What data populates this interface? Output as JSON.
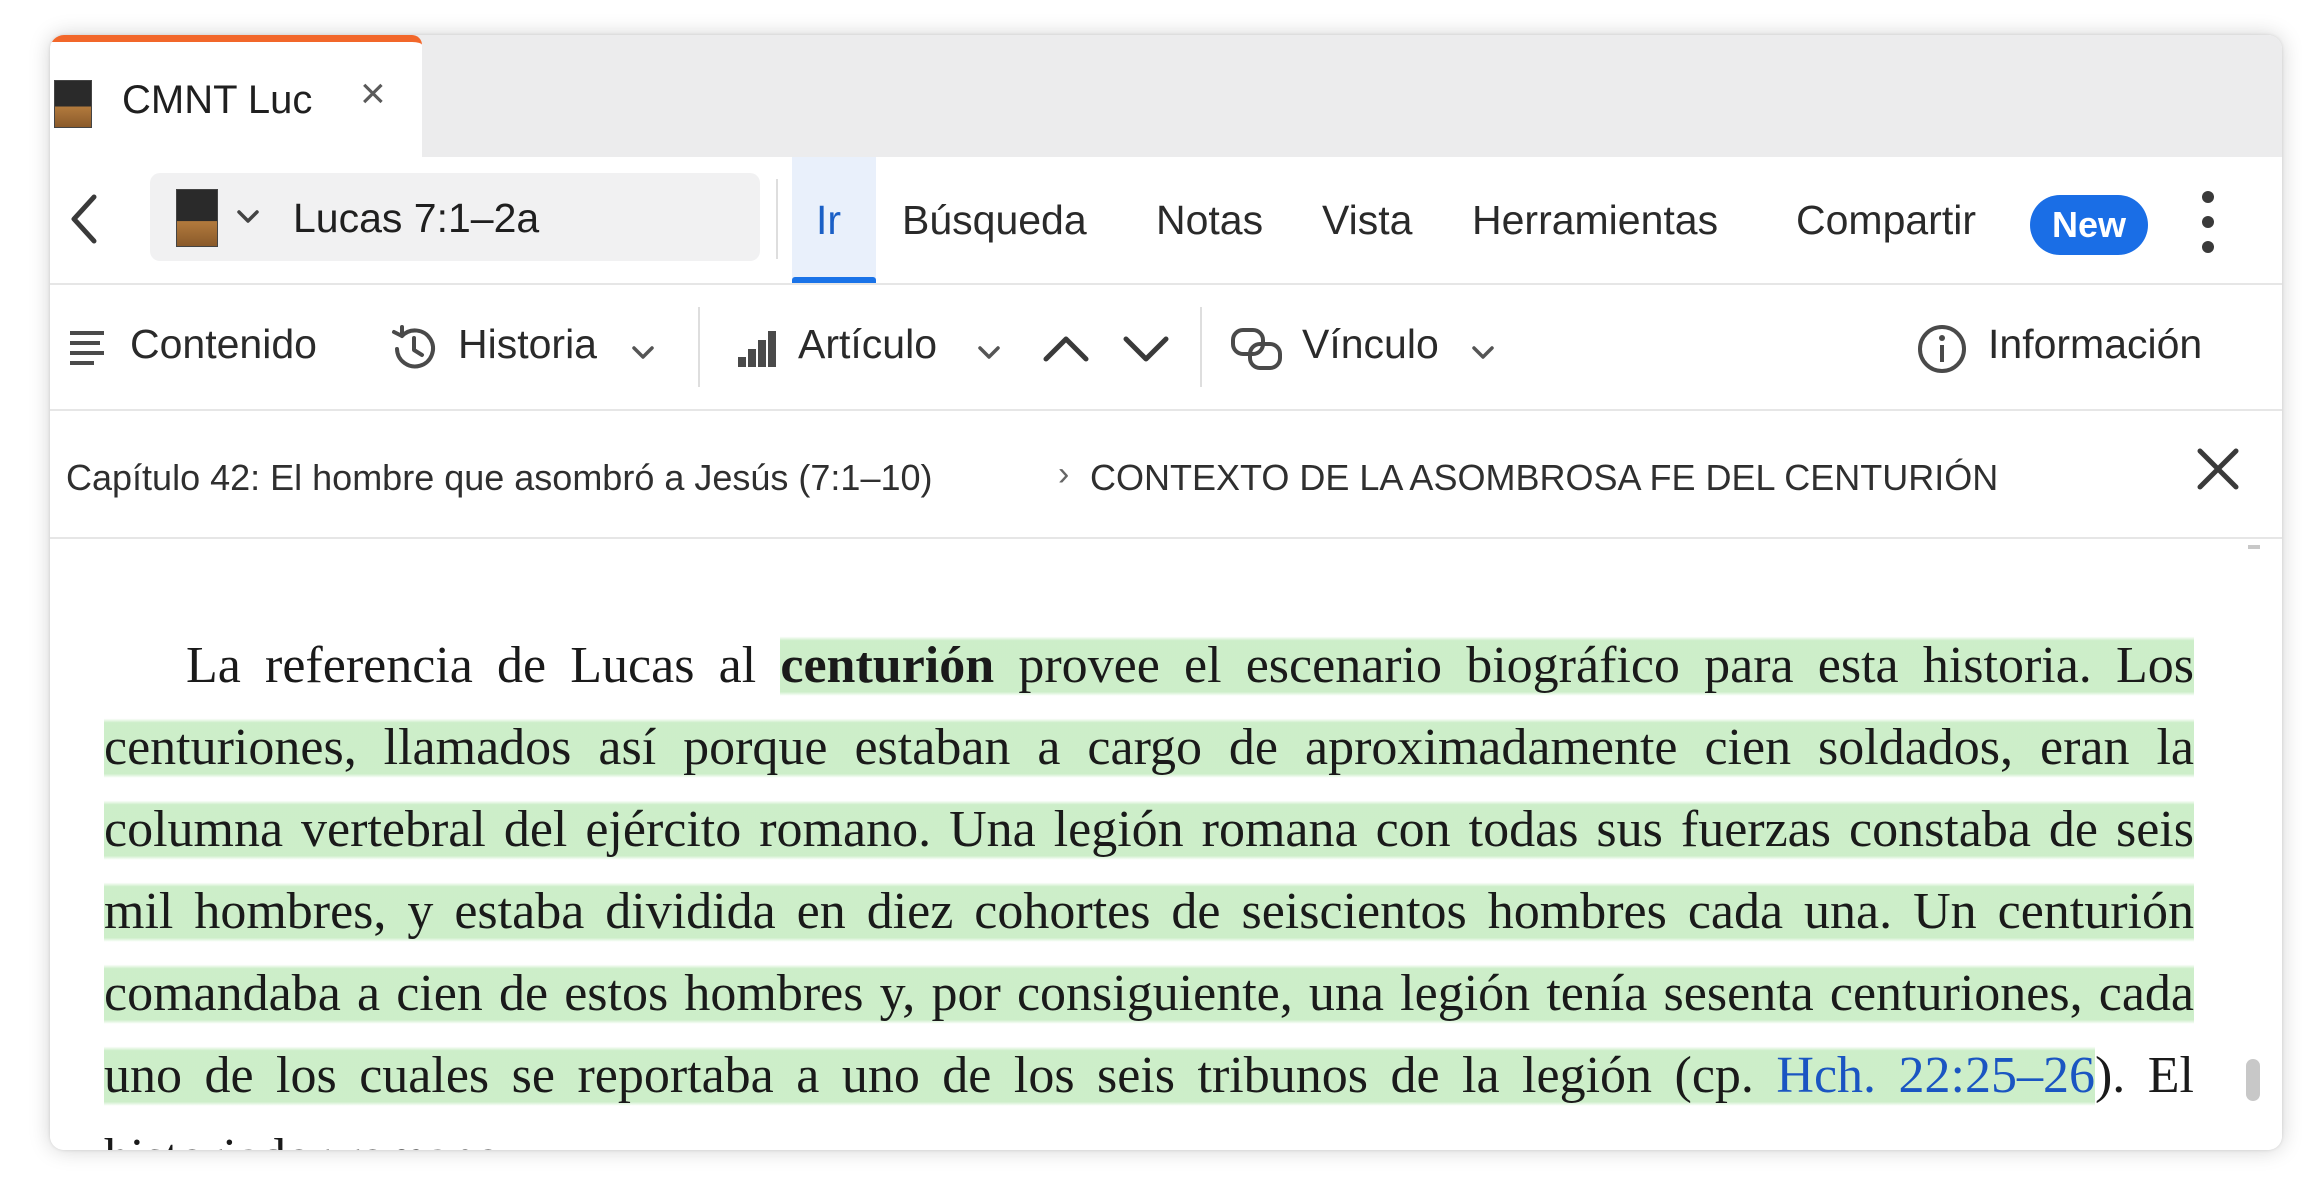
{
  "tab": {
    "title": "CMNT Luc",
    "close_glyph": "×"
  },
  "nav": {
    "reference": "Lucas 7:1–2a",
    "menu": [
      "Ir",
      "Búsqueda",
      "Notas",
      "Vista",
      "Herramientas",
      "Compartir"
    ],
    "active_menu": "Ir",
    "new_badge": "New"
  },
  "toolbar": {
    "contenido": "Contenido",
    "historia": "Historia",
    "articulo": "Artículo",
    "vinculo": "Vínculo",
    "informacion": "Información"
  },
  "breadcrumb": {
    "chapter": "Capítulo 42: El hombre que asombró a Jesús (7:1–10)",
    "separator": "›",
    "section": "CONTEXTO DE LA ASOMBROSA FE DEL CENTURIÓN"
  },
  "article": {
    "t1": "La referencia de Lucas al ",
    "t2": "centurión",
    "t3": " provee el escenario biográfico para esta historia. Los centuriones, llamados así porque estaban a cargo de aproximadamente cien soldados, eran la columna vertebral del ejército romano. Una legión romana con todas sus fuerzas constaba de seis mil hombres, y estaba dividida en diez cohortes de seiscientos hombres cada una. Un centurión comandaba a cien de estos hombres y, por consiguiente, una legión tenía sesenta centuriones, cada uno de los cuales se reportaba a uno de los seis tribunos de la legión (cp. ",
    "link": "Hch. 22:25–26",
    "t4": "). El historiador romano"
  },
  "colors": {
    "accent": "#1a73e8",
    "tab_accent": "#f2672a",
    "highlight": "#caedc6",
    "link": "#1a55c2"
  },
  "icons": {
    "back": "chevron-left-icon",
    "close": "close-icon",
    "contenido": "list-icon",
    "historia": "history-icon",
    "articulo": "bar-chart-icon",
    "vinculo": "link-icon",
    "informacion": "info-icon",
    "more": "kebab-icon"
  }
}
